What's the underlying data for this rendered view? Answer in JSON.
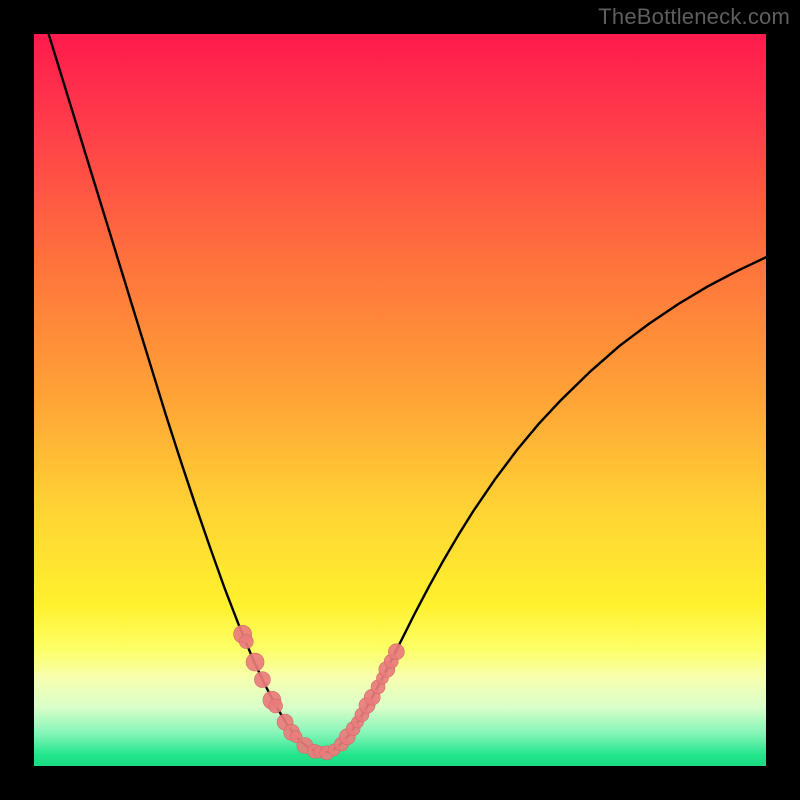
{
  "branding": {
    "watermark": "TheBottleneck.com"
  },
  "colors": {
    "frame": "#000000",
    "curve": "#000000",
    "marker_fill": "#e97c7c",
    "marker_stroke": "#d26a6a",
    "gradient_stops": [
      {
        "offset": 0.0,
        "color": "#ff1a4d"
      },
      {
        "offset": 0.12,
        "color": "#ff3b4a"
      },
      {
        "offset": 0.3,
        "color": "#ff6f3d"
      },
      {
        "offset": 0.5,
        "color": "#ffa436"
      },
      {
        "offset": 0.66,
        "color": "#ffd633"
      },
      {
        "offset": 0.78,
        "color": "#fff12e"
      },
      {
        "offset": 0.84,
        "color": "#fdff66"
      },
      {
        "offset": 0.88,
        "color": "#f7ffb0"
      },
      {
        "offset": 0.92,
        "color": "#d9ffc9"
      },
      {
        "offset": 0.955,
        "color": "#86f5b8"
      },
      {
        "offset": 0.985,
        "color": "#22e58c"
      },
      {
        "offset": 1.0,
        "color": "#18db82"
      }
    ]
  },
  "chart_data": {
    "type": "line",
    "title": "",
    "xlabel": "",
    "ylabel": "",
    "xlim": [
      0,
      1
    ],
    "ylim": [
      0,
      1
    ],
    "series": [
      {
        "name": "bottleneck-curve",
        "x": [
          0.02,
          0.04,
          0.06,
          0.08,
          0.1,
          0.12,
          0.14,
          0.16,
          0.18,
          0.2,
          0.22,
          0.24,
          0.26,
          0.28,
          0.3,
          0.315,
          0.33,
          0.345,
          0.355,
          0.365,
          0.375,
          0.385,
          0.395,
          0.405,
          0.415,
          0.43,
          0.445,
          0.46,
          0.48,
          0.5,
          0.52,
          0.54,
          0.56,
          0.58,
          0.6,
          0.63,
          0.66,
          0.69,
          0.72,
          0.76,
          0.8,
          0.84,
          0.88,
          0.92,
          0.96,
          1.0
        ],
        "y": [
          1.0,
          0.935,
          0.87,
          0.805,
          0.74,
          0.675,
          0.61,
          0.545,
          0.48,
          0.418,
          0.358,
          0.3,
          0.244,
          0.192,
          0.144,
          0.112,
          0.083,
          0.058,
          0.044,
          0.033,
          0.025,
          0.02,
          0.018,
          0.02,
          0.026,
          0.042,
          0.064,
          0.09,
          0.128,
          0.168,
          0.208,
          0.246,
          0.282,
          0.316,
          0.348,
          0.392,
          0.432,
          0.468,
          0.5,
          0.539,
          0.574,
          0.604,
          0.631,
          0.655,
          0.676,
          0.695
        ]
      }
    ],
    "markers": [
      {
        "name": "highlight-points",
        "x": [
          0.285,
          0.29,
          0.302,
          0.312,
          0.325,
          0.33,
          0.343,
          0.352,
          0.358,
          0.37,
          0.383,
          0.39,
          0.4,
          0.41,
          0.42,
          0.428,
          0.436,
          0.442,
          0.448,
          0.455,
          0.462,
          0.47,
          0.476,
          0.482,
          0.488,
          0.495
        ],
        "y": [
          0.18,
          0.17,
          0.142,
          0.118,
          0.09,
          0.082,
          0.06,
          0.046,
          0.04,
          0.028,
          0.02,
          0.019,
          0.018,
          0.022,
          0.03,
          0.04,
          0.051,
          0.06,
          0.07,
          0.083,
          0.094,
          0.108,
          0.12,
          0.132,
          0.143,
          0.156
        ],
        "r": [
          9,
          7,
          9,
          8,
          9,
          7,
          8,
          8,
          6,
          8,
          7,
          6,
          7,
          6,
          7,
          8,
          7,
          6,
          7,
          8,
          8,
          7,
          6,
          8,
          7,
          8
        ]
      }
    ]
  }
}
